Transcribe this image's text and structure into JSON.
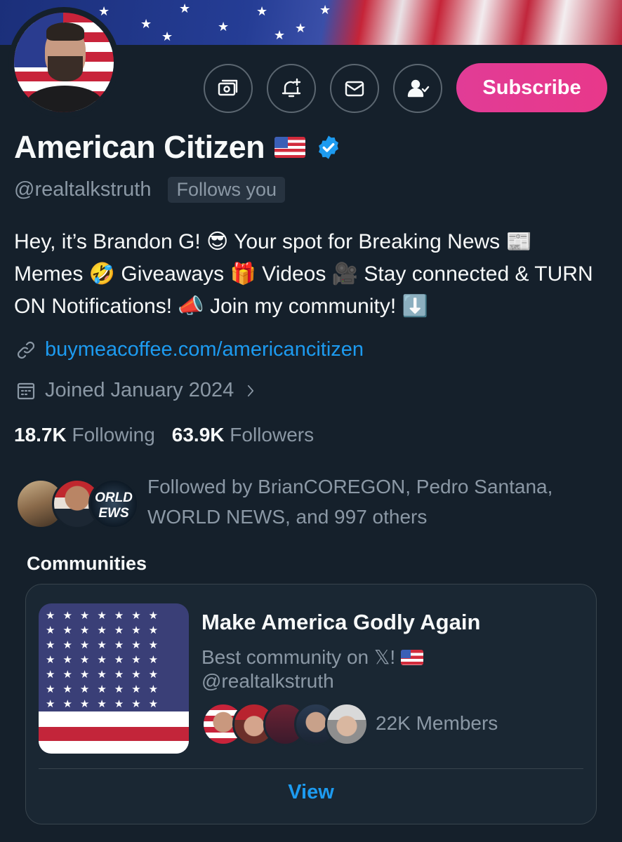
{
  "header": {
    "subscribe_label": "Subscribe",
    "actions": [
      {
        "name": "tip-icon"
      },
      {
        "name": "notification-bell-icon"
      },
      {
        "name": "message-icon"
      },
      {
        "name": "following-icon"
      }
    ]
  },
  "profile": {
    "name": "American Citizen",
    "handle": "@realtalkstruth",
    "follows_you": "Follows you",
    "bio": {
      "seg1": "Hey, it’s Brandon G! ",
      "seg2": " Your spot for Breaking News ",
      "seg3": "Memes ",
      "seg4": " Giveaways ",
      "seg5": " Videos ",
      "seg6": " Stay connected & TURN ON Notifications! ",
      "seg7": " Join my community! "
    },
    "website": "buymeacoffee.com/americancitizen",
    "joined": "Joined January 2024",
    "following_count": "18.7K",
    "following_label": "Following",
    "followers_count": "63.9K",
    "followers_label": "Followers",
    "followed_by_line1": "Followed by BrianCOREGON, Pedro Santana,",
    "followed_by_line2": "WORLD NEWS, and 997 others"
  },
  "communities": {
    "title": "Communities",
    "card": {
      "name": "Make America Godly Again",
      "description": "Best community on 𝕏!",
      "handle": "@realtalkstruth",
      "members": "22K Members",
      "view_label": "View"
    }
  },
  "colors": {
    "background": "#15202b",
    "accent": "#1d9bf0",
    "subscribe": "#e13c96",
    "muted": "#8b98a5"
  }
}
